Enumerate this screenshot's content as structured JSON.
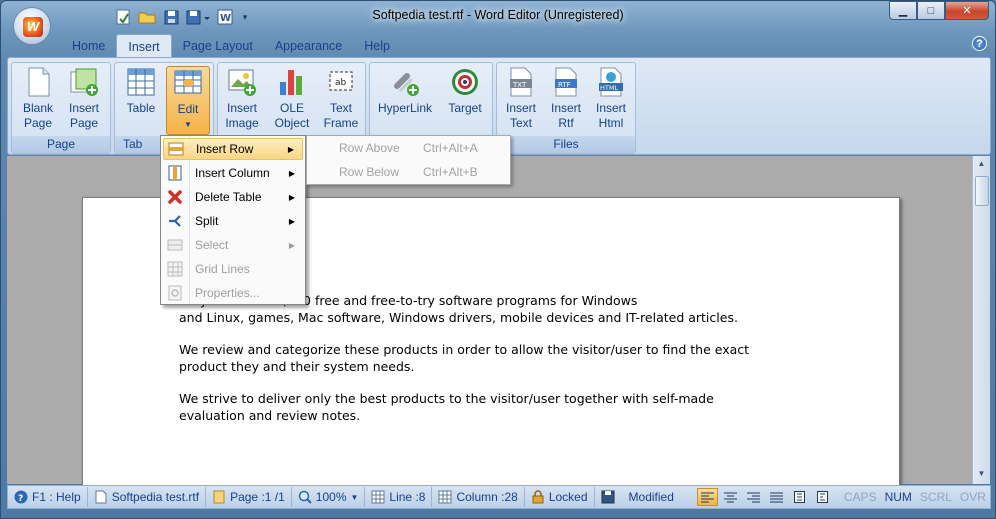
{
  "window": {
    "title": "Softpedia test.rtf - Word Editor (Unregistered)",
    "logo_letter": "W"
  },
  "controls": {
    "minimize": "▁",
    "maximize": "□",
    "close": "✕"
  },
  "tabs": [
    {
      "label": "Home",
      "active": false
    },
    {
      "label": "Insert",
      "active": true
    },
    {
      "label": "Page Layout",
      "active": false
    },
    {
      "label": "Appearance",
      "active": false
    },
    {
      "label": "Help",
      "active": false
    }
  ],
  "ribbon": {
    "groups": {
      "page": "Page",
      "table": "Tab",
      "files": "Files"
    },
    "buttons": {
      "blank_page": [
        "Blank",
        "Page"
      ],
      "insert_page": [
        "Insert",
        "Page"
      ],
      "table": [
        "Table",
        ""
      ],
      "edit": [
        "Edit",
        ""
      ],
      "insert_image": [
        "Insert",
        "Image"
      ],
      "ole_object": [
        "OLE",
        "Object"
      ],
      "text_frame": [
        "Text",
        "Frame"
      ],
      "hyperlink": [
        "HyperLink",
        ""
      ],
      "target": [
        "Target",
        ""
      ],
      "insert_text": [
        "Insert",
        "Text"
      ],
      "insert_rtf": [
        "Insert",
        "Rtf"
      ],
      "insert_html": [
        "Insert",
        "Html"
      ]
    }
  },
  "context_menu": {
    "items": [
      {
        "label": "Insert Row",
        "submenu": true,
        "disabled": false,
        "highlighted": true
      },
      {
        "label": "Insert Column",
        "submenu": true,
        "disabled": false,
        "highlighted": false
      },
      {
        "label": "Delete Table",
        "submenu": true,
        "disabled": false,
        "highlighted": false
      },
      {
        "label": "Split",
        "submenu": true,
        "disabled": false,
        "highlighted": false
      },
      {
        "label": "Select",
        "submenu": true,
        "disabled": true,
        "highlighted": false
      },
      {
        "label": "Grid Lines",
        "submenu": false,
        "disabled": true,
        "highlighted": false
      },
      {
        "label": "Properties...",
        "submenu": false,
        "disabled": true,
        "highlighted": false
      }
    ],
    "submenu": [
      {
        "label": "Row Above",
        "shortcut": "Ctrl+Alt+A"
      },
      {
        "label": "Row Below",
        "shortcut": "Ctrl+Alt+B"
      }
    ]
  },
  "document": {
    "paragraphs": [
      "... ry of over 400,000 free and free-to-try software programs for Windows",
      "and Linux, games, Mac software, Windows drivers, mobile devices and IT-related articles.",
      "We review and categorize these products in order to allow the visitor/user to find the exact",
      "product they and their system needs.",
      "We strive to deliver only the best products to the visitor/user together with self-made",
      "evaluation and review notes."
    ]
  },
  "status": {
    "help": "F1 : Help",
    "file": "Softpedia test.rtf",
    "page": "Page :1 /1",
    "zoom": "100%",
    "line": "Line :8",
    "column": "Column :28",
    "locked": "Locked",
    "modified": "Modified",
    "caps": "CAPS",
    "num": "NUM",
    "scrl": "SCRL",
    "ovr": "OVR"
  },
  "colors": {
    "accent": "#15428b",
    "highlight": "#fbd681",
    "ribbon": "#dfe9f5"
  }
}
